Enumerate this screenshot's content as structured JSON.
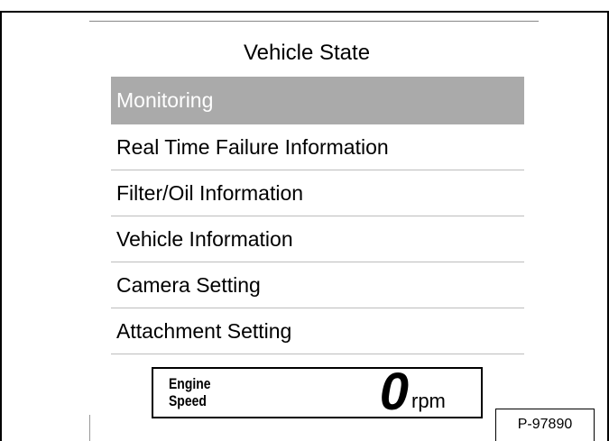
{
  "screen": {
    "title": "Vehicle State"
  },
  "menu": {
    "items": [
      {
        "label": "Monitoring",
        "selected": true
      },
      {
        "label": "Real Time Failure Information",
        "selected": false
      },
      {
        "label": "Filter/Oil Information",
        "selected": false
      },
      {
        "label": "Vehicle Information",
        "selected": false
      },
      {
        "label": "Camera Setting",
        "selected": false
      },
      {
        "label": "Attachment Setting",
        "selected": false
      }
    ],
    "selected_bg": "#aaaaaa",
    "selected_fg": "#ffffff"
  },
  "engine_speed": {
    "label": "Engine\nSpeed",
    "value": "0",
    "unit": "rpm"
  },
  "figure_ref": "P-97890"
}
